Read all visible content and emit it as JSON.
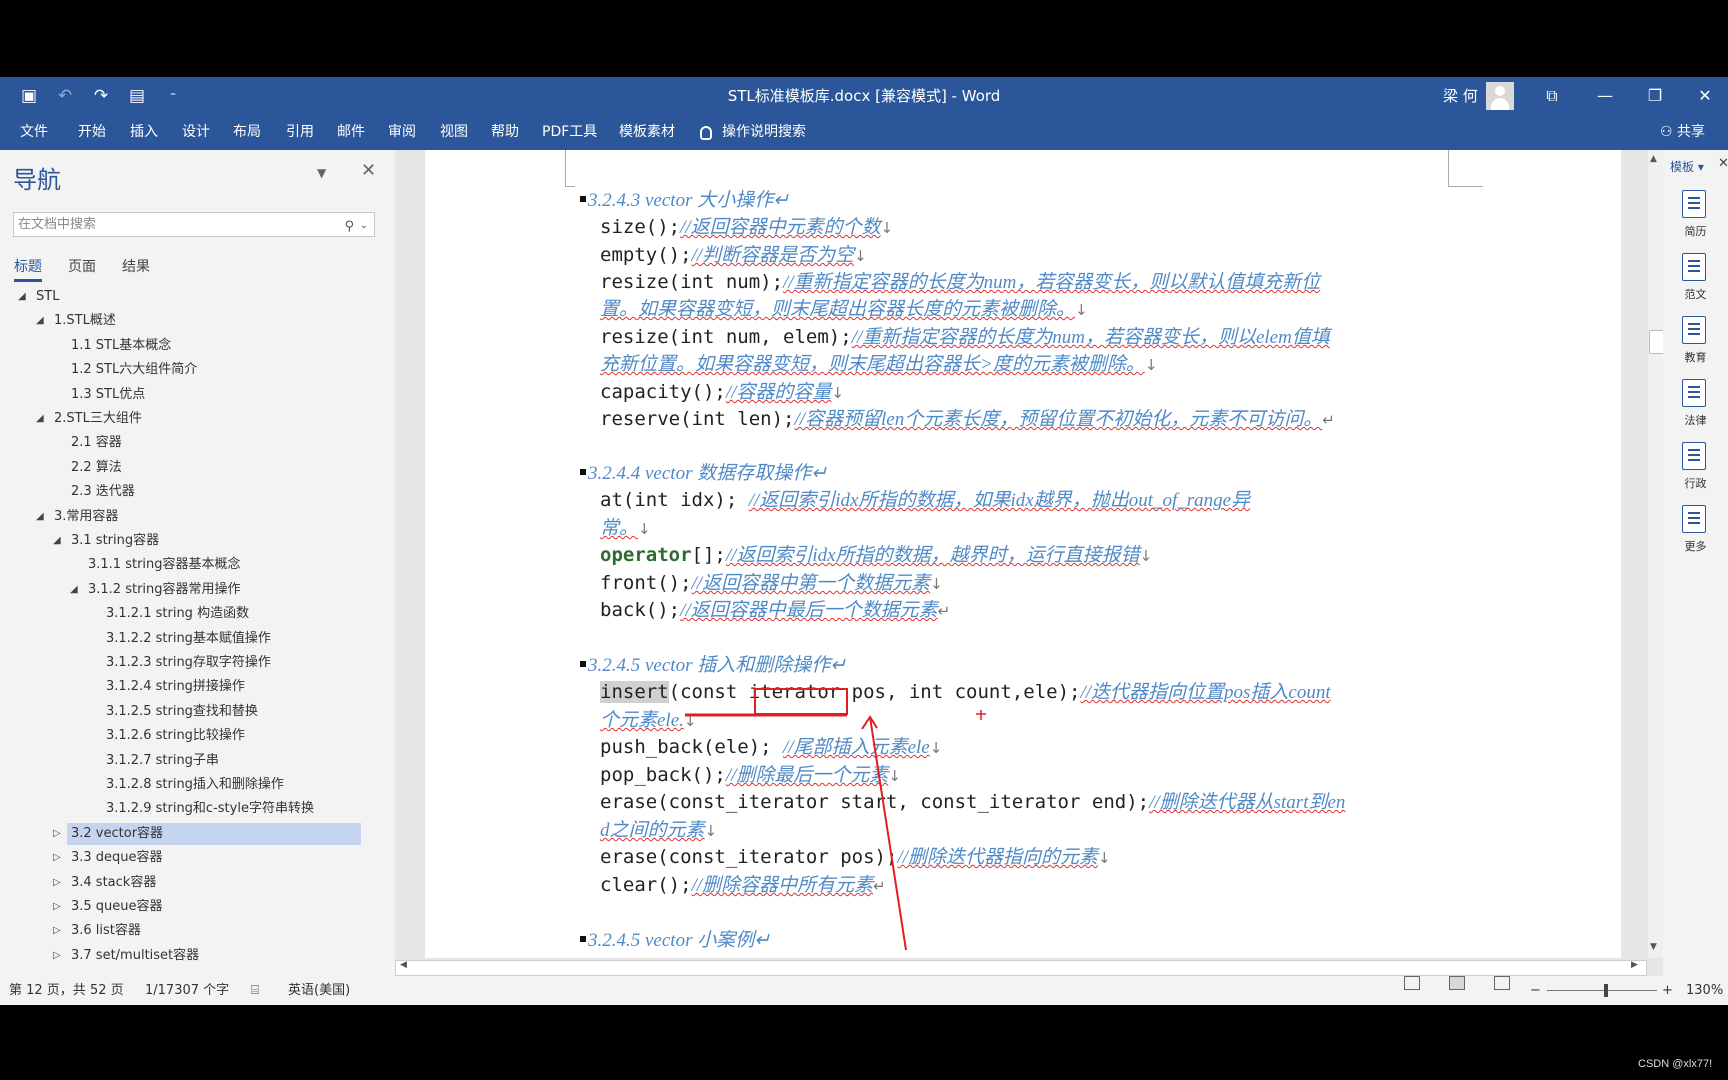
{
  "titlebar": {
    "doc_title": "STL标准模板库.docx [兼容模式]  -  Word",
    "user": "梁 何",
    "qat_more": "⁼"
  },
  "ribbon": {
    "tabs": [
      "文件",
      "开始",
      "插入",
      "设计",
      "布局",
      "引用",
      "邮件",
      "审阅",
      "视图",
      "帮助",
      "PDF工具",
      "模板素材"
    ],
    "tellme": "操作说明搜索",
    "share": "共享"
  },
  "nav": {
    "title": "导航",
    "search_placeholder": "在文档中搜索",
    "tabs": [
      "标题",
      "页面",
      "结果"
    ],
    "items": [
      {
        "label": "STL",
        "level": 0,
        "tw": "◢"
      },
      {
        "label": "1.STL概述",
        "level": 1,
        "tw": "◢"
      },
      {
        "label": "1.1 STL基本概念",
        "level": 2,
        "tw": ""
      },
      {
        "label": "1.2 STL六大组件简介",
        "level": 2,
        "tw": ""
      },
      {
        "label": "1.3 STL优点",
        "level": 2,
        "tw": ""
      },
      {
        "label": "2.STL三大组件",
        "level": 1,
        "tw": "◢"
      },
      {
        "label": "2.1 容器",
        "level": 2,
        "tw": ""
      },
      {
        "label": "2.2 算法",
        "level": 2,
        "tw": ""
      },
      {
        "label": "2.3 迭代器",
        "level": 2,
        "tw": ""
      },
      {
        "label": "3.常用容器",
        "level": 1,
        "tw": "◢"
      },
      {
        "label": "3.1 string容器",
        "level": 2,
        "tw": "◢"
      },
      {
        "label": "3.1.1 string容器基本概念",
        "level": 3,
        "tw": ""
      },
      {
        "label": "3.1.2 string容器常用操作",
        "level": 3,
        "tw": "◢"
      },
      {
        "label": "3.1.2.1 string 构造函数",
        "level": 4,
        "tw": ""
      },
      {
        "label": "3.1.2.2 string基本赋值操作",
        "level": 4,
        "tw": ""
      },
      {
        "label": "3.1.2.3 string存取字符操作",
        "level": 4,
        "tw": ""
      },
      {
        "label": "3.1.2.4 string拼接操作",
        "level": 4,
        "tw": ""
      },
      {
        "label": "3.1.2.5 string查找和替换",
        "level": 4,
        "tw": ""
      },
      {
        "label": "3.1.2.6 string比较操作",
        "level": 4,
        "tw": ""
      },
      {
        "label": "3.1.2.7 string子串",
        "level": 4,
        "tw": ""
      },
      {
        "label": "3.1.2.8 string插入和删除操作",
        "level": 4,
        "tw": ""
      },
      {
        "label": "3.1.2.9 string和c-style字符串转换",
        "level": 4,
        "tw": ""
      },
      {
        "label": "3.2 vector容器",
        "level": 2,
        "tw": "▷",
        "selected": true
      },
      {
        "label": "3.3 deque容器",
        "level": 2,
        "tw": "▷"
      },
      {
        "label": "3.4 stack容器",
        "level": 2,
        "tw": "▷"
      },
      {
        "label": "3.5 queue容器",
        "level": 2,
        "tw": "▷"
      },
      {
        "label": "3.6 list容器",
        "level": 2,
        "tw": "▷"
      },
      {
        "label": "3.7 set/multiset容器",
        "level": 2,
        "tw": "▷"
      }
    ]
  },
  "rpane": {
    "title": "模板",
    "items": [
      "简历",
      "范文",
      "教育",
      "法律",
      "行政",
      "更多"
    ]
  },
  "status": {
    "page": "第 12 页，共 52 页",
    "words": "1/17307 个字",
    "lang": "英语(美国)",
    "zoom": "130%"
  },
  "doc": {
    "lines": [
      {
        "type": "head",
        "text": "3.2.4.3 vector 大小操作↵"
      },
      {
        "type": "code",
        "code": "size();",
        "cmt": "//返回容器中元素的个数",
        "mark": "↓"
      },
      {
        "type": "code",
        "code": "empty();",
        "cmt": "//判断容器是否为空",
        "mark": "↓"
      },
      {
        "type": "code",
        "code": "resize(int num);",
        "cmt": "//重新指定容器的长度为num，若容器变长，则以默认值填充新位",
        "mark": ""
      },
      {
        "type": "cont",
        "cmt": "置。如果容器变短，则末尾超出容器长度的元素被删除。",
        "mark": "↓"
      },
      {
        "type": "code",
        "code": "resize(int num, elem);",
        "cmt": "//重新指定容器的长度为num，若容器变长，则以elem值填",
        "mark": ""
      },
      {
        "type": "cont",
        "cmt": "充新位置。如果容器变短，则末尾超出容器长>度的元素被删除。",
        "mark": "↓"
      },
      {
        "type": "code",
        "code": "capacity();",
        "cmt": "//容器的容量",
        "mark": "↓"
      },
      {
        "type": "code",
        "code": "reserve(int len);",
        "cmt": "//容器预留len个元素长度，预留位置不初始化，元素不可访问。",
        "mark": "↵"
      },
      {
        "type": "head",
        "text": "3.2.4.4 vector 数据存取操作↵"
      },
      {
        "type": "code",
        "code": "at(int idx); ",
        "cmt": "//返回索引idx所指的数据，如果idx越界，抛出out_of_range异",
        "mark": ""
      },
      {
        "type": "cont",
        "cmt": "常。",
        "mark": "↓"
      },
      {
        "type": "code",
        "code": "[];",
        "op": "operator",
        "cmt": "//返回索引idx所指的数据，越界时，运行直接报错",
        "mark": "↓"
      },
      {
        "type": "code",
        "code": "front();",
        "cmt": "//返回容器中第一个数据元素",
        "mark": "↓"
      },
      {
        "type": "code",
        "code": "back();",
        "cmt": "//返回容器中最后一个数据元素",
        "mark": "↵"
      },
      {
        "type": "head",
        "text": "3.2.4.5 vector 插入和删除操作↵"
      },
      {
        "type": "code",
        "code": "insert(const iterator pos, int count,ele);",
        "hl": "insert",
        "cmt": "//迭代器指向位置pos插入count",
        "mark": ""
      },
      {
        "type": "cont",
        "cmt": "个元素ele.",
        "mark": "↓"
      },
      {
        "type": "code",
        "code": "push_back(ele); ",
        "cmt": "//尾部插入元素ele",
        "mark": "↓"
      },
      {
        "type": "code",
        "code": "pop_back();",
        "cmt": "//删除最后一个元素",
        "mark": "↓"
      },
      {
        "type": "code",
        "code": "erase(const_iterator start, const_iterator end);",
        "cmt": "//删除迭代器从start到en",
        "mark": ""
      },
      {
        "type": "cont",
        "cmt": "d之间的元素",
        "mark": "↓"
      },
      {
        "type": "code",
        "code": "erase(const_iterator pos);",
        "cmt": "//删除迭代器指向的元素",
        "mark": "↓"
      },
      {
        "type": "code",
        "code": "clear();",
        "cmt": "//删除容器中所有元素",
        "mark": "↵"
      },
      {
        "type": "head",
        "text": "3.2.4.5 vector 小案例↵"
      }
    ]
  },
  "watermark": "CSDN @xlx77!"
}
